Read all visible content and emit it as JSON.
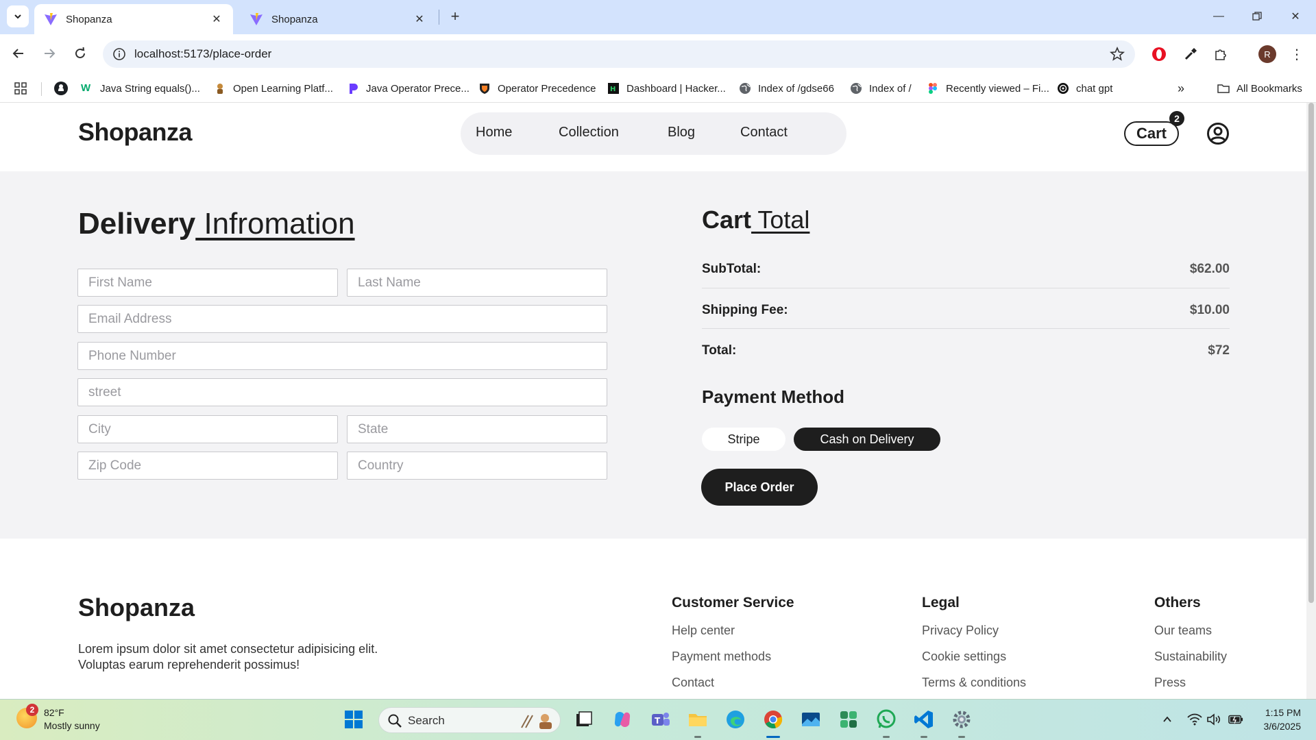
{
  "browser": {
    "tabs": [
      {
        "title": "Shopanza",
        "active": true
      },
      {
        "title": "Shopanza",
        "active": false
      }
    ],
    "url": "localhost:5173/place-order",
    "profile_initial": "R",
    "bookmarks": [
      {
        "label": "Java String equals()...",
        "icon": "w3schools-icon"
      },
      {
        "label": "Open Learning Platf...",
        "icon": "open-learning-icon"
      },
      {
        "label": "Java Operator Prece...",
        "icon": "p-logo-icon"
      },
      {
        "label": "Operator Precedence",
        "icon": "princeton-icon"
      },
      {
        "label": "Dashboard | Hacker...",
        "icon": "hackerrank-icon"
      },
      {
        "label": "Index of /gdse66",
        "icon": "globe-icon"
      },
      {
        "label": "Index of /",
        "icon": "globe-icon"
      },
      {
        "label": "Recently viewed – Fi...",
        "icon": "figma-icon"
      },
      {
        "label": "chat gpt",
        "icon": "openai-icon"
      }
    ],
    "all_bookmarks": "All Bookmarks"
  },
  "header": {
    "logo": "Shopanza",
    "nav": [
      "Home",
      "Collection",
      "Blog",
      "Contact"
    ],
    "cart_label": "Cart",
    "cart_count": "2"
  },
  "delivery": {
    "title_bold": "Delivery",
    "title_rest": " Infromation",
    "placeholders": {
      "first_name": "First Name",
      "last_name": "Last Name",
      "email": "Email Address",
      "phone": "Phone Number",
      "street": "street",
      "city": "City",
      "state": "State",
      "zip": "Zip Code",
      "country": "Country"
    }
  },
  "cart_total": {
    "title_bold": "Cart",
    "title_rest": " Total",
    "subtotal_label": "SubTotal:",
    "subtotal_value": "$62.00",
    "shipping_label": "Shipping Fee:",
    "shipping_value": "$10.00",
    "total_label": "Total:",
    "total_value": "$72"
  },
  "payment": {
    "title": "Payment Method",
    "options": [
      "Stripe",
      "Cash on Delivery"
    ],
    "selected": "Cash on Delivery",
    "place_order": "Place Order"
  },
  "footer": {
    "logo": "Shopanza",
    "description": "Lorem ipsum dolor sit amet consectetur adipisicing elit. Voluptas earum reprehenderit possimus!",
    "columns": [
      {
        "title": "Customer Service",
        "links": [
          "Help center",
          "Payment methods",
          "Contact"
        ]
      },
      {
        "title": "Legal",
        "links": [
          "Privacy Policy",
          "Cookie settings",
          "Terms & conditions"
        ]
      },
      {
        "title": "Others",
        "links": [
          "Our teams",
          "Sustainability",
          "Press"
        ]
      }
    ]
  },
  "taskbar": {
    "weather_badge": "2",
    "temperature": "82°F",
    "condition": "Mostly sunny",
    "search_label": "Search",
    "time": "1:15 PM",
    "date": "3/6/2025"
  },
  "colors": {
    "accent": "#1e1e1e",
    "page_bg": "#f3f3f5",
    "chrome_tabbar": "#d3e3fd"
  }
}
